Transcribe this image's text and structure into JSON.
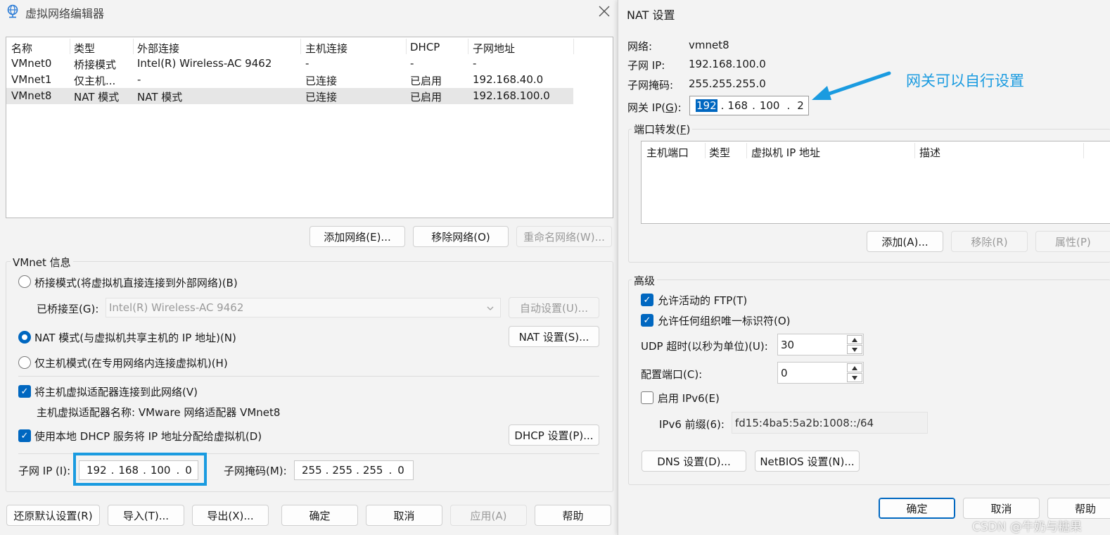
{
  "left_window": {
    "title": "虚拟网络编辑器",
    "icons": {
      "app": "network-globe-icon",
      "close": "close-icon"
    },
    "table": {
      "columns": [
        "名称",
        "类型",
        "外部连接",
        "主机连接",
        "DHCP",
        "子网地址"
      ],
      "rows": [
        [
          "VMnet0",
          "桥接模式",
          "Intel(R) Wireless-AC 9462",
          "-",
          "-",
          "-"
        ],
        [
          "VMnet1",
          "仅主机...",
          "-",
          "已连接",
          "已启用",
          "192.168.40.0"
        ],
        [
          "VMnet8",
          "NAT 模式",
          "NAT 模式",
          "已连接",
          "已启用",
          "192.168.100.0"
        ]
      ],
      "selected_row": 2
    },
    "buttons": {
      "add_network": "添加网络(E)...",
      "remove_network": "移除网络(O)",
      "rename_network": "重命名网络(W)..."
    },
    "vmnet_info": {
      "title": "VMnet 信息",
      "bridge_mode": "桥接模式(将虚拟机直接连接到外部网络)(B)",
      "bridged_to_label": "已桥接至(G):",
      "bridged_to_value": "Intel(R) Wireless-AC 9462",
      "auto_settings": "自动设置(U)...",
      "nat_mode": "NAT 模式(与虚拟机共享主机的 IP 地址)(N)",
      "nat_settings": "NAT 设置(S)...",
      "host_only_mode": "仅主机模式(在专用网络内连接虚拟机)(H)",
      "selected_mode": "nat",
      "connect_adapter": "将主机虚拟适配器连接到此网络(V)",
      "adapter_name": "主机虚拟适配器名称: VMware 网络适配器 VMnet8",
      "use_dhcp": "使用本地 DHCP 服务将 IP 地址分配给虚拟机(D)",
      "dhcp_settings": "DHCP 设置(P)...",
      "subnet_ip_label": "子网 IP (I):",
      "subnet_ip": [
        "192",
        "168",
        "100",
        "0"
      ],
      "subnet_mask_label": "子网掩码(M):",
      "subnet_mask": [
        "255",
        "255",
        "255",
        "0"
      ]
    },
    "bottom_buttons": {
      "restore": "还原默认设置(R)",
      "import": "导入(T)...",
      "export": "导出(X)...",
      "ok": "确定",
      "cancel": "取消",
      "apply": "应用(A)",
      "help": "帮助"
    },
    "highlight_color": "#1a9be0"
  },
  "right_window": {
    "title": "NAT 设置",
    "network_label": "网络:",
    "network_value": "vmnet8",
    "subnet_ip_label": "子网 IP:",
    "subnet_ip_value": "192.168.100.0",
    "subnet_mask_label": "子网掩码:",
    "subnet_mask_value": "255.255.255.0",
    "gateway_label_pre": "网关 IP(",
    "gateway_label_key": "G",
    "gateway_label_post": "):",
    "gateway_ip": [
      "192",
      "168",
      "100",
      "2"
    ],
    "port_forwarding": {
      "title_pre": "端口转发(",
      "title_key": "F",
      "title_post": ")",
      "columns": [
        "主机端口",
        "类型",
        "虚拟机 IP 地址",
        "描述"
      ],
      "add": "添加(A)...",
      "remove": "移除(R)",
      "properties": "属性(P)"
    },
    "advanced": {
      "title": "高级",
      "allow_ftp": "允许活动的 FTP(T)",
      "allow_org_id": "允许任何组织唯一标识符(O)",
      "udp_timeout_label": "UDP 超时(以秒为单位)(U):",
      "udp_timeout_value": "30",
      "config_port_label": "配置端口(C):",
      "config_port_value": "0",
      "enable_ipv6": "启用 IPv6(E)",
      "ipv6_prefix_label": "IPv6 前缀(6):",
      "ipv6_prefix_value": "fd15:4ba5:5a2b:1008::/64"
    },
    "buttons": {
      "dns": "DNS 设置(D)...",
      "netbios": "NetBIOS 设置(N)...",
      "ok": "确定",
      "cancel": "取消",
      "help": "帮助"
    }
  },
  "annotation": {
    "text": "网关可以自行设置",
    "color": "#1a9be0"
  },
  "watermark": "CSDN @牛奶与糖果"
}
